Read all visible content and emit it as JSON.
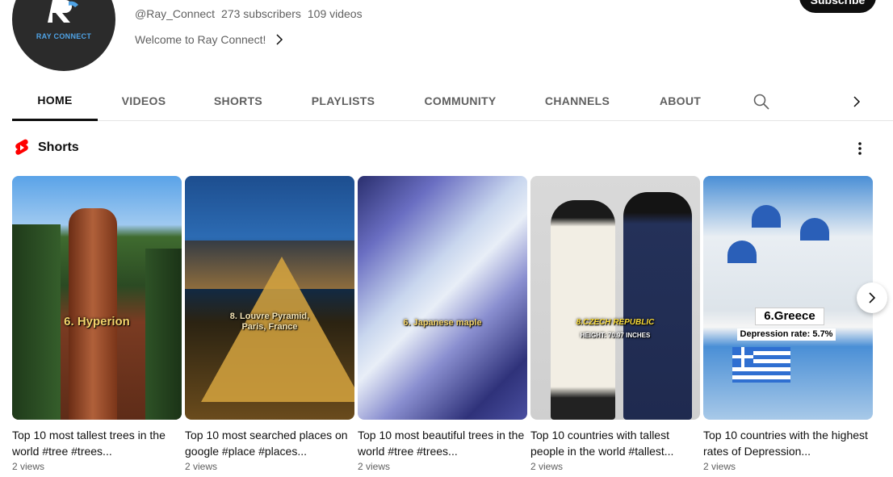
{
  "channel": {
    "avatar_text": "RAY CONNECT",
    "handle": "@Ray_Connect",
    "subscribers": "273 subscribers",
    "videos": "109 videos",
    "welcome": "Welcome to Ray Connect!",
    "subscribe_label": "Subscribe"
  },
  "tabs": [
    {
      "label": "HOME",
      "active": true
    },
    {
      "label": "VIDEOS"
    },
    {
      "label": "SHORTS"
    },
    {
      "label": "PLAYLISTS"
    },
    {
      "label": "COMMUNITY"
    },
    {
      "label": "CHANNELS"
    },
    {
      "label": "ABOUT"
    }
  ],
  "tab_icons": {
    "search": "search-icon",
    "next": "chevron-right-icon"
  },
  "shorts": {
    "title": "Shorts",
    "items": [
      {
        "caption": "6. Hyperion",
        "title": "Top 10 most tallest trees in the world #tree #trees...",
        "views": "2 views"
      },
      {
        "caption": "8. Louvre Pyramid, Paris, France",
        "title": "Top 10 most searched places on google #place #places...",
        "views": "2 views"
      },
      {
        "caption": "6. Japanese maple",
        "title": "Top 10 most beautiful trees in the world #tree #trees...",
        "views": "2 views"
      },
      {
        "caption": "8.CZECH REPUBLIC",
        "caption2": "HEIGHT: 70.97 INCHES",
        "title": "Top 10 countries with tallest people in the world #tallest...",
        "views": "2 views"
      },
      {
        "caption": "6.Greece",
        "caption2": "Depression rate: 5.7%",
        "title": "Top 10 countries with the highest rates of Depression...",
        "views": "2 views"
      }
    ]
  },
  "colors": {
    "accent": "#0f0f0f",
    "shorts_red": "#ff0000",
    "muted": "#606060"
  }
}
